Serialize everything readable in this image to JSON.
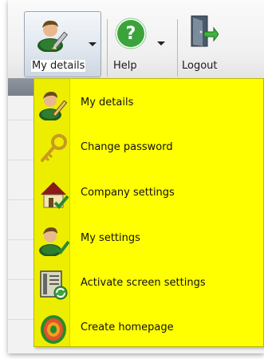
{
  "toolbar": {
    "my_details": {
      "label": "My details",
      "icon": "user-edit-icon"
    },
    "help": {
      "label": "Help",
      "icon": "help-icon"
    },
    "logout": {
      "label": "Logout",
      "icon": "logout-door-icon"
    }
  },
  "menu": {
    "background_color": "#ffff00",
    "items": [
      {
        "label": "My details",
        "icon": "user-edit-icon"
      },
      {
        "label": "Change password",
        "icon": "key-icon"
      },
      {
        "label": "Company settings",
        "icon": "house-check-icon"
      },
      {
        "label": "My settings",
        "icon": "user-check-icon"
      },
      {
        "label": "Activate screen settings",
        "icon": "screen-refresh-icon"
      },
      {
        "label": "Create homepage",
        "icon": "target-icon"
      }
    ]
  }
}
